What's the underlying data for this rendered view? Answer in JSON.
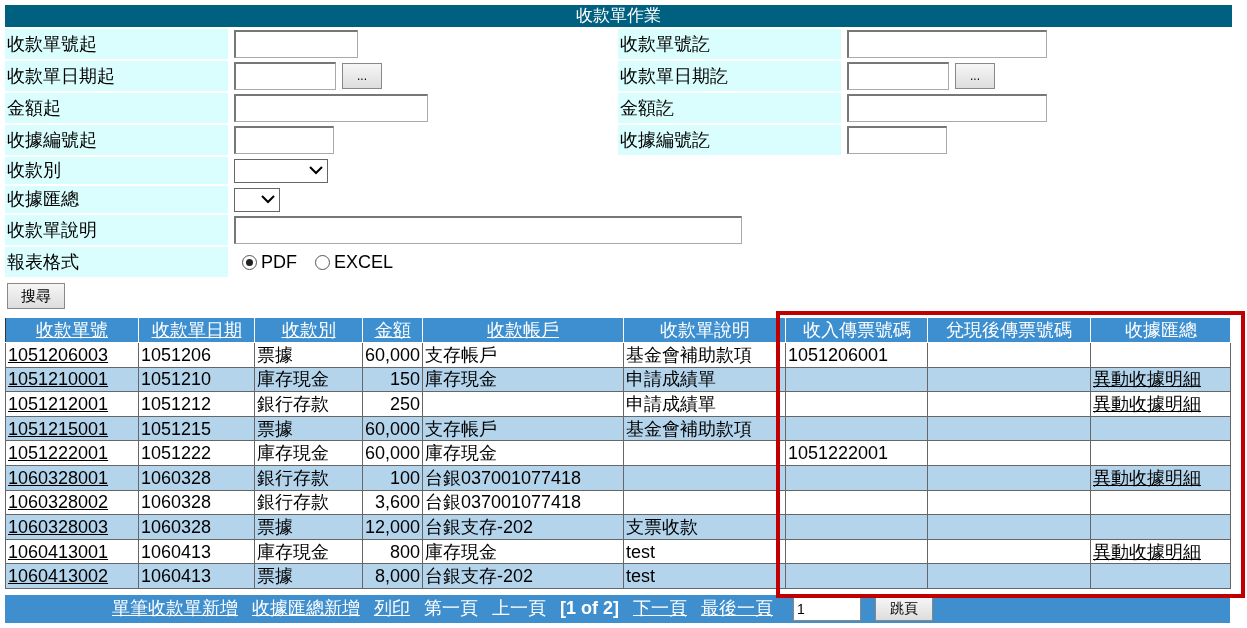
{
  "title": "收款單作業",
  "form": {
    "rows": [
      {
        "left": {
          "label": "收款單號起",
          "field": {
            "kind": "text"
          }
        },
        "right": {
          "label": "收款單號訖",
          "field": {
            "kind": "text"
          }
        }
      },
      {
        "left": {
          "label": "收款單日期起",
          "field": {
            "kind": "date",
            "button": "..."
          }
        },
        "right": {
          "label": "收款單日期訖",
          "field": {
            "kind": "date",
            "button": "..."
          }
        }
      },
      {
        "left": {
          "label": "金額起",
          "field": {
            "kind": "text"
          }
        },
        "right": {
          "label": "金額訖",
          "field": {
            "kind": "text"
          }
        }
      },
      {
        "left": {
          "label": "收據編號起",
          "field": {
            "kind": "text"
          }
        },
        "right": {
          "label": "收據編號訖",
          "field": {
            "kind": "text"
          }
        }
      },
      {
        "left": {
          "label": "收款別",
          "field": {
            "kind": "select"
          }
        }
      },
      {
        "left": {
          "label": "收據匯總",
          "field": {
            "kind": "select"
          }
        }
      },
      {
        "left": {
          "label": "收款單說明",
          "field": {
            "kind": "text"
          }
        }
      },
      {
        "left": {
          "label": "報表格式",
          "field": {
            "kind": "radio",
            "options": [
              {
                "label": "PDF",
                "selected": true
              },
              {
                "label": "EXCEL",
                "selected": false
              }
            ]
          }
        }
      }
    ],
    "search_button": "搜尋"
  },
  "table": {
    "columns": [
      {
        "label": "收款單號",
        "sortable": true,
        "highlighted": false
      },
      {
        "label": "收款單日期",
        "sortable": true,
        "highlighted": false
      },
      {
        "label": "收款別",
        "sortable": true,
        "highlighted": false
      },
      {
        "label": "金額",
        "sortable": true,
        "highlighted": false
      },
      {
        "label": "收款帳戶",
        "sortable": true,
        "highlighted": false
      },
      {
        "label": "收款單說明",
        "sortable": false,
        "highlighted": false
      },
      {
        "label": "收入傳票號碼",
        "sortable": false,
        "highlighted": true
      },
      {
        "label": "兌現後傳票號碼",
        "sortable": false,
        "highlighted": true
      },
      {
        "label": "收據匯總",
        "sortable": false,
        "highlighted": true
      }
    ],
    "rows": [
      [
        {
          "kind": "link",
          "text": "1051206003"
        },
        "1051206",
        "票據",
        "60,000",
        "支存帳戶",
        "基金會補助款項",
        "1051206001",
        null,
        null
      ],
      [
        {
          "kind": "link",
          "text": "1051210001"
        },
        "1051210",
        "庫存現金",
        "150",
        "庫存現金",
        "申請成績單",
        null,
        null,
        {
          "kind": "link",
          "text": "異動收據明細"
        }
      ],
      [
        {
          "kind": "link",
          "text": "1051212001"
        },
        "1051212",
        "銀行存款",
        "250",
        null,
        "申請成績單",
        null,
        null,
        {
          "kind": "link",
          "text": "異動收據明細"
        }
      ],
      [
        {
          "kind": "link",
          "text": "1051215001"
        },
        "1051215",
        "票據",
        "60,000",
        "支存帳戶",
        "基金會補助款項",
        null,
        null,
        null
      ],
      [
        {
          "kind": "link",
          "text": "1051222001"
        },
        "1051222",
        "庫存現金",
        "60,000",
        "庫存現金",
        null,
        "1051222001",
        null,
        null
      ],
      [
        {
          "kind": "link",
          "text": "1060328001"
        },
        "1060328",
        "銀行存款",
        "100",
        "台銀037001077418",
        null,
        null,
        null,
        {
          "kind": "link",
          "text": "異動收據明細"
        }
      ],
      [
        {
          "kind": "link",
          "text": "1060328002"
        },
        "1060328",
        "銀行存款",
        "3,600",
        "台銀037001077418",
        null,
        null,
        null,
        null
      ],
      [
        {
          "kind": "link",
          "text": "1060328003"
        },
        "1060328",
        "票據",
        "12,000",
        "台銀支存-202",
        "支票收款",
        null,
        null,
        null
      ],
      [
        {
          "kind": "link",
          "text": "1060413001"
        },
        "1060413",
        "庫存現金",
        "800",
        "庫存現金",
        "test",
        null,
        null,
        {
          "kind": "link",
          "text": "異動收據明細"
        }
      ],
      [
        {
          "kind": "link",
          "text": "1060413002"
        },
        "1060413",
        "票據",
        "8,000",
        "台銀支存-202",
        "test",
        null,
        null,
        null
      ]
    ]
  },
  "footer": {
    "items": [
      {
        "kind": "link",
        "text": "單筆收款單新增"
      },
      {
        "kind": "link",
        "text": "收據匯總新增"
      },
      {
        "kind": "link",
        "text": "列印"
      },
      {
        "kind": "text",
        "text": "第一頁"
      },
      {
        "kind": "text",
        "text": "上一頁"
      },
      {
        "kind": "page",
        "text": "[1 of 2]"
      },
      {
        "kind": "link",
        "text": "下一頁"
      },
      {
        "kind": "link",
        "text": "最後一頁"
      }
    ],
    "page_input": "1",
    "jump_button": "跳頁"
  }
}
